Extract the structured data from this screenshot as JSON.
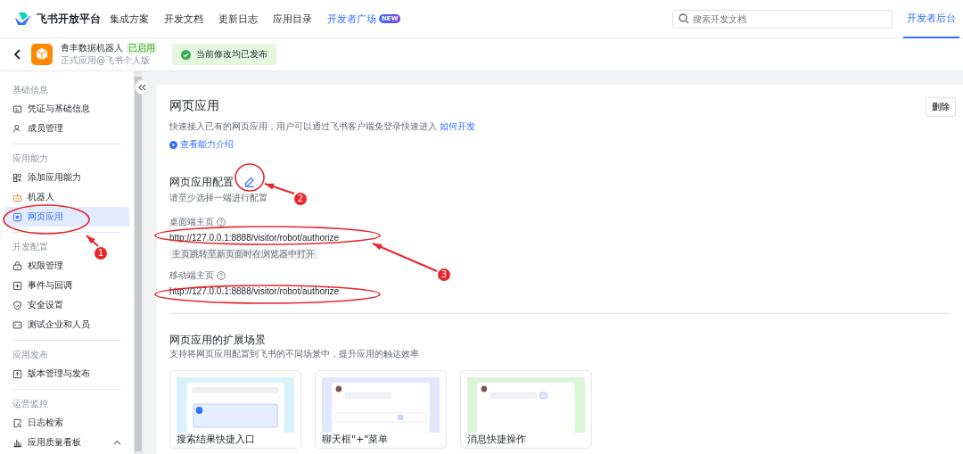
{
  "nav": {
    "logo": "飞书开放平台",
    "items": [
      {
        "label": "集成方案",
        "highlighted": false
      },
      {
        "label": "开发文档",
        "highlighted": false
      },
      {
        "label": "更新日志",
        "highlighted": false
      },
      {
        "label": "应用目录",
        "highlighted": false
      },
      {
        "label": "开发者广场",
        "highlighted": true,
        "badge": "NEW"
      }
    ],
    "search": {
      "placeholder": "搜索开发文档"
    },
    "console": {
      "label": "开发者后台",
      "selected": true
    }
  },
  "app": {
    "name": "青丰数据机器人",
    "status": "已启用",
    "subtitle": "正式应用@飞书个人版",
    "publish_status": "当前修改均已发布"
  },
  "sidebar": [
    {
      "heading": "基础信息",
      "items": [
        {
          "label": "凭证与基础信息",
          "selected": false
        },
        {
          "label": "成员管理",
          "selected": false
        }
      ]
    },
    {
      "heading": "应用能力",
      "items": [
        {
          "label": "添加应用能力",
          "selected": false
        },
        {
          "label": "机器人",
          "selected": false
        },
        {
          "label": "网页应用",
          "selected": true
        }
      ]
    },
    {
      "heading": "开发配置",
      "items": [
        {
          "label": "权限管理",
          "selected": false
        },
        {
          "label": "事件与回调",
          "selected": false
        },
        {
          "label": "安全设置",
          "selected": false
        },
        {
          "label": "测试企业和人员",
          "selected": false
        }
      ]
    },
    {
      "heading": "应用发布",
      "items": [
        {
          "label": "版本管理与发布",
          "selected": false
        }
      ]
    },
    {
      "heading": "运营监控",
      "items": [
        {
          "label": "日志检索",
          "selected": false
        },
        {
          "label": "应用质量看板",
          "selected": false,
          "expanded": true
        }
      ]
    }
  ],
  "page": {
    "title": "网页应用",
    "delete_button": "删除",
    "description": "快速接入已有的网页应用，用户可以通过飞书客户端免登录快速进入",
    "description_link": "如何开发",
    "intro_link": "查看能力介绍",
    "config": {
      "title": "网页应用配置",
      "hint": "请至少选择一端进行配置",
      "fields": [
        {
          "label": "桌面端主页",
          "value": "http://127.0.0.1:8888/visitor/robot/authorize",
          "tag": "主页跳转至新页面时在浏览器中打开"
        },
        {
          "label": "移动端主页",
          "value": "http://127.0.0.1:8888/visitor/robot/authorize"
        }
      ]
    },
    "scenes": {
      "title": "网页应用的扩展场景",
      "description": "支持将网页应用配置到飞书的不同场景中，提升应用的触达效率",
      "cards": [
        {
          "title": "搜索结果快捷入口",
          "color": "#d9f1fb"
        },
        {
          "title": "聊天框\"+\"菜单",
          "color": "#e1e8fb"
        },
        {
          "title": "消息快捷操作",
          "color": "#dcf5d8"
        }
      ]
    }
  },
  "annotations": [
    {
      "label": "1"
    },
    {
      "label": "2"
    },
    {
      "label": "3"
    }
  ]
}
